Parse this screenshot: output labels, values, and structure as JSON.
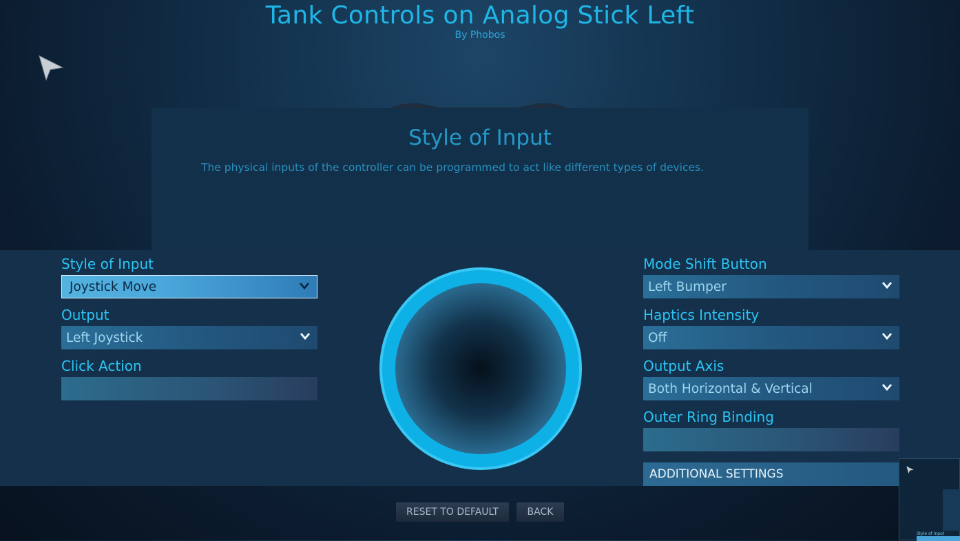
{
  "header": {
    "title": "Tank Controls on Analog Stick Left",
    "byline": "By Phobos"
  },
  "info": {
    "title": "Style of Input",
    "description": "The physical inputs of the controller can be programmed to act like different types of devices."
  },
  "left_settings": {
    "style_of_input": {
      "label": "Style of Input",
      "value": "Joystick Move"
    },
    "output": {
      "label": "Output",
      "value": "Left Joystick"
    },
    "click_action": {
      "label": "Click Action",
      "value": ""
    }
  },
  "right_settings": {
    "mode_shift": {
      "label": "Mode Shift Button",
      "value": "Left Bumper"
    },
    "haptics": {
      "label": "Haptics Intensity",
      "value": "Off"
    },
    "output_axis": {
      "label": "Output Axis",
      "value": "Both Horizontal & Vertical"
    },
    "outer_ring": {
      "label": "Outer Ring Binding",
      "value": ""
    },
    "additional_settings": "ADDITIONAL SETTINGS"
  },
  "buttons": {
    "reset": "RESET TO DEFAULT",
    "back": "BACK"
  },
  "mini_preview": {
    "title": "Style of Input"
  },
  "colors": {
    "accent": "#2cc4f3",
    "ring": "#0fb3e8",
    "panel": "#14304a"
  }
}
